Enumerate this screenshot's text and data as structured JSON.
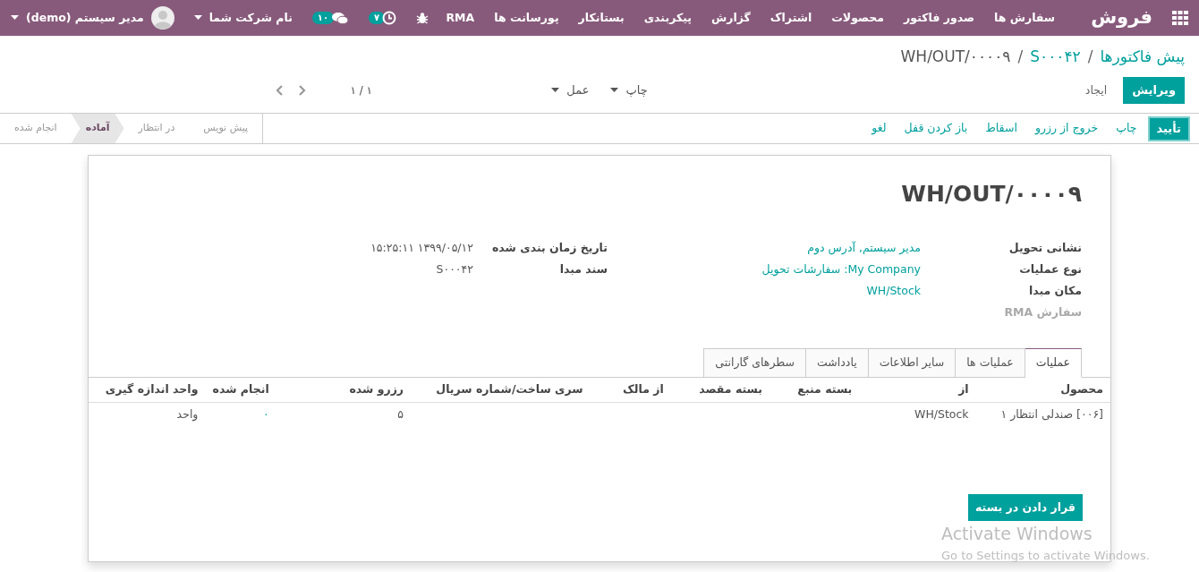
{
  "navbar": {
    "app_name": "فروش",
    "menu": [
      "سفارش ها",
      "صدور فاکتور",
      "محصولات",
      "اشتراک",
      "گزارش",
      "پیکربندی",
      "بستانکار",
      "پورسانت ها",
      "RMA"
    ],
    "activity_count": "۷",
    "message_count": "۱۰",
    "company": "نام شرکت شما",
    "user": "مدیر سیستم (demo)"
  },
  "breadcrumb_separator": "/",
  "breadcrumbs": [
    {
      "label": "پیش فاکتورها",
      "current": false
    },
    {
      "label": "S۰۰۰۴۲",
      "current": false
    },
    {
      "label": "WH/OUT/۰۰۰۰۹",
      "current": true
    }
  ],
  "control_buttons": [
    {
      "label": "ویرایش",
      "primary": true
    },
    {
      "label": "ایجاد",
      "primary": false
    }
  ],
  "dropdowns": [
    "چاپ",
    "عمل"
  ],
  "pager": "۱ / ۱",
  "status_buttons": [
    {
      "label": "تأیید",
      "primary": true
    },
    {
      "label": "چاپ",
      "primary": false
    },
    {
      "label": "خروج از رزرو",
      "primary": false
    },
    {
      "label": "اسقاط",
      "primary": false
    },
    {
      "label": "باز کردن قفل",
      "primary": false
    },
    {
      "label": "لغو",
      "primary": false
    }
  ],
  "stages": [
    {
      "label": "پیش نویس",
      "selected": false
    },
    {
      "label": "در انتظار",
      "selected": false
    },
    {
      "label": "آماده",
      "selected": true
    },
    {
      "label": "انجام شده",
      "selected": false
    }
  ],
  "form": {
    "title": "WH/OUT/۰۰۰۰۹",
    "fields_right": [
      {
        "label": "نشانی تحویل",
        "value": "مدیر سیستم, آدرس دوم",
        "muted": false
      },
      {
        "label": "نوع عملیات",
        "value": "My Company: سفارشات تحویل",
        "muted": false
      },
      {
        "label": "مکان مبدا",
        "value": "WH/Stock",
        "muted": false
      },
      {
        "label": "سفارش RMA",
        "muted": true
      }
    ],
    "fields_left": [
      {
        "label": "تاریخ زمان بندی شده",
        "value": "۱۳۹۹/۰۵/۱۲ ۱۵:۲۵:۱۱",
        "muted": false
      },
      {
        "label": "سند مبدا",
        "value": "S۰۰۰۴۲",
        "muted": false
      }
    ],
    "tabs": [
      {
        "label": "عملیات",
        "selected": true
      },
      {
        "label": "عملیات ها",
        "selected": false
      },
      {
        "label": "سایر اطلاعات",
        "selected": false
      },
      {
        "label": "یادداشت",
        "selected": false
      },
      {
        "label": "سطرهای گارانتی",
        "selected": false
      }
    ],
    "table": {
      "columns": [
        "محصول",
        "از",
        "بسته منبع",
        "بسته مقصد",
        "از مالک",
        "سری ساخت/شماره سریال",
        "رزرو شده",
        "انجام شده",
        "واحد اندازه گیری"
      ],
      "rows": [
        [
          "[۰۰۶] صندلی انتظار ۱",
          "WH/Stock",
          "",
          "",
          "",
          "",
          "۵",
          "۰",
          "واحد"
        ]
      ]
    },
    "put_in_pack": "قرار دادن در بسته"
  },
  "os_notice": {
    "title": "Activate Windows",
    "subtitle": "Go to Settings to activate Windows."
  }
}
